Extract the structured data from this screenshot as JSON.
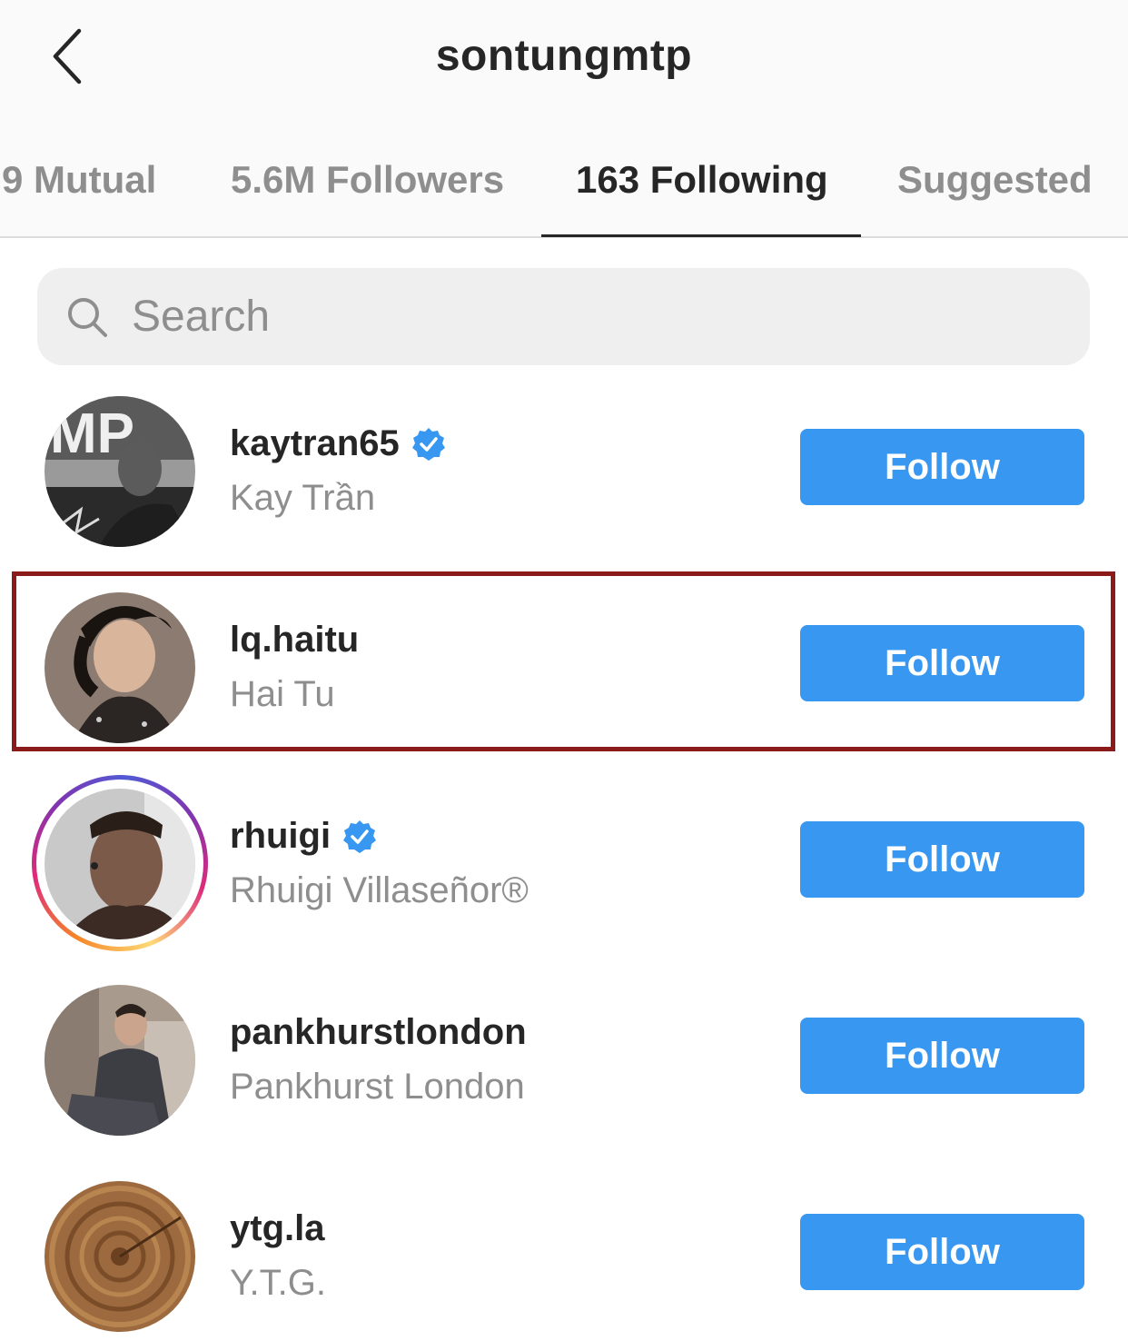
{
  "header": {
    "title": "sontungmtp",
    "back_icon": "chevron-left-icon"
  },
  "tabs": [
    {
      "label": "9 Mutual",
      "active": false
    },
    {
      "label": "5.6M Followers",
      "active": false
    },
    {
      "label": "163 Following",
      "active": true
    },
    {
      "label": "Suggested",
      "active": false
    }
  ],
  "search": {
    "placeholder": "Search",
    "value": ""
  },
  "list": [
    {
      "username": "kaytran65",
      "full_name": "Kay Trần",
      "verified": true,
      "story_ring": false,
      "button": "Follow"
    },
    {
      "username": "lq.haitu",
      "full_name": "Hai Tu",
      "verified": false,
      "story_ring": false,
      "button": "Follow"
    },
    {
      "username": "rhuigi",
      "full_name": "Rhuigi Villaseñor®",
      "verified": true,
      "story_ring": true,
      "button": "Follow"
    },
    {
      "username": "pankhurstlondon",
      "full_name": "Pankhurst London",
      "verified": false,
      "story_ring": false,
      "button": "Follow"
    },
    {
      "username": "ytg.la",
      "full_name": "Y.T.G.",
      "verified": false,
      "story_ring": false,
      "button": "Follow"
    }
  ],
  "colors": {
    "follow_button": "#3897f0",
    "verified_badge": "#3897f0",
    "highlight_border": "#8b1a1a"
  }
}
